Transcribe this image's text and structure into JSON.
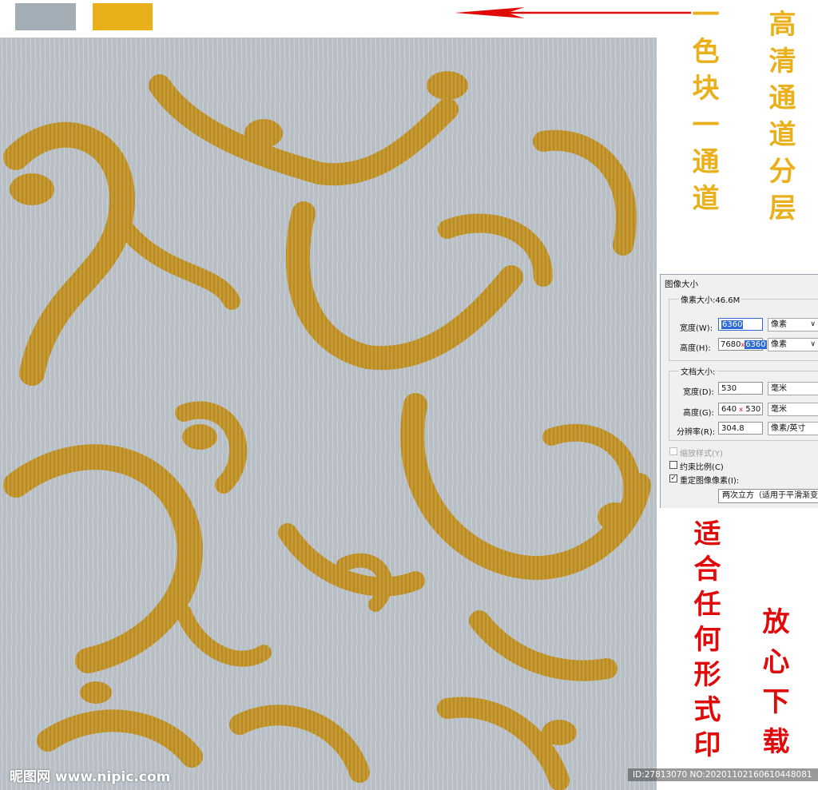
{
  "colors": {
    "swatch_gray": "#a3adb6",
    "swatch_gold": "#eab01b",
    "arrow_red": "#e10a0a",
    "pattern_bg": "#b7bec4",
    "ornament_gold": "#c89a2e"
  },
  "captions": {
    "channel_note": "一色块一通道",
    "hd_note": "高清通道分层",
    "print_note": "适合任何形式印",
    "download_note": "放心下载"
  },
  "dialog": {
    "title": "图像大小",
    "pixel_size_label": "像素大小:46.6M",
    "width_label": "宽度(W):",
    "width_value": "6360",
    "width_unit": "像素",
    "height_label": "高度(H):",
    "height_old": "7680",
    "height_value": "6360",
    "height_unit": "像素",
    "doc_size_label": "文档大小:",
    "doc_width_label": "宽度(D):",
    "doc_width_value": "530",
    "doc_width_unit": "毫米",
    "doc_height_label": "高度(G):",
    "doc_height_old": "640",
    "doc_height_value": "530",
    "doc_height_unit": "毫米",
    "resolution_label": "分辨率(R):",
    "resolution_value": "304.8",
    "resolution_unit": "像素/英寸",
    "scale_styles_label": "缩放样式(Y)",
    "constrain_label": "约束比例(C)",
    "resample_label": "重定图像像素(I):",
    "resample_value": "两次立方（适用于平滑渐变",
    "x_mark": "x"
  },
  "footer": {
    "logo": "昵图网 www.nipic.com",
    "id_text": "ID:27813070 NO:20201102160610448081"
  }
}
